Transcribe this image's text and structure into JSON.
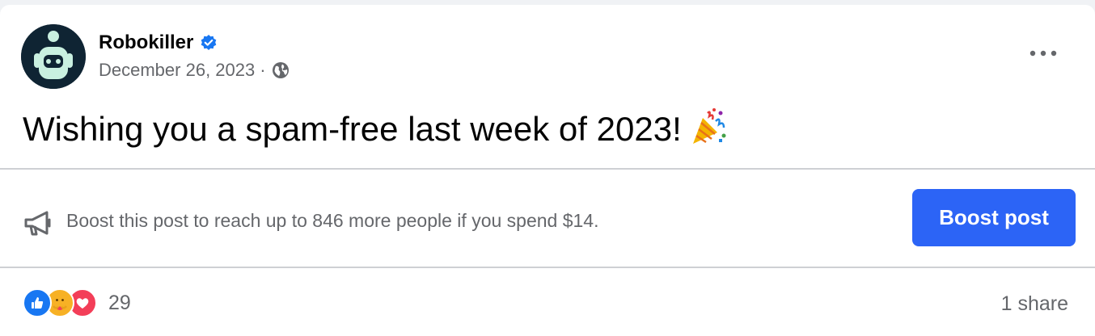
{
  "post": {
    "author": "Robokiller",
    "verified": true,
    "date": "December 26, 2023",
    "separator": "·",
    "privacy_icon": "globe-icon",
    "more_icon": "more-options-icon",
    "text": "Wishing you a spam-free last week of 2023!",
    "text_emoji": "party-popper-emoji"
  },
  "boost": {
    "icon": "megaphone-icon",
    "message": "Boost this post to reach up to 846 more people if you spend $14.",
    "button_label": "Boost post"
  },
  "engagement": {
    "reaction_icons": [
      "like-icon",
      "care-icon",
      "love-icon"
    ],
    "reaction_count": "29",
    "shares_label": "1 share"
  },
  "colors": {
    "accent": "#2c64f6",
    "verified": "#1877f2",
    "secondary_text": "#65676b",
    "divider": "#ced0d4"
  }
}
